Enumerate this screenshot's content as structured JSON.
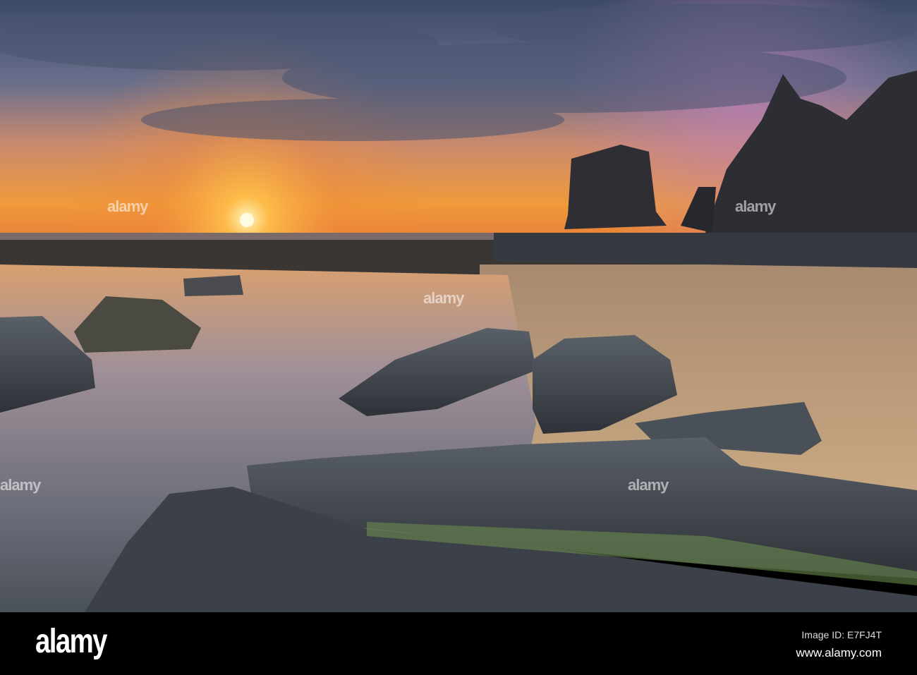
{
  "watermark": {
    "text": "alamy"
  },
  "footer": {
    "logo": "alamy",
    "image_id": "Image ID: E7FJ4T",
    "website": "www.alamy.com"
  }
}
